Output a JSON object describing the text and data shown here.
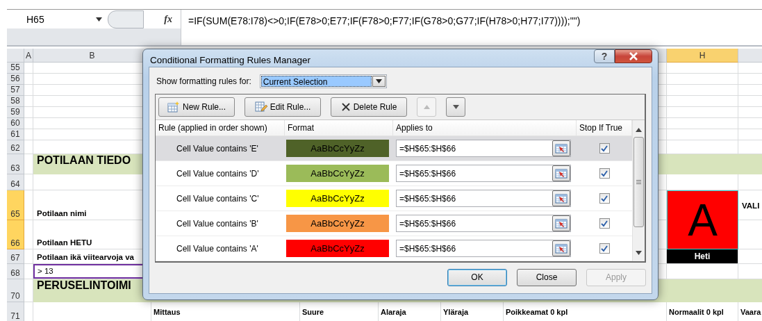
{
  "formula_bar": {
    "name_box": "H65",
    "function_label": "fx",
    "formula": "=IF(SUM(E78:I78)<>0;IF(E78>0;E77;IF(F78>0;F77;IF(G78>0;G77;IF(H78>0;H77;I77))));\"\")"
  },
  "column_headers": [
    {
      "label": "A",
      "selected": false
    },
    {
      "label": "B",
      "selected": false
    },
    {
      "label": "H",
      "selected": true
    }
  ],
  "row_headers": [
    {
      "label": "55",
      "selected": false
    },
    {
      "label": "56",
      "selected": false
    },
    {
      "label": "57",
      "selected": false
    },
    {
      "label": "58",
      "selected": false
    },
    {
      "label": "59",
      "selected": false
    },
    {
      "label": "60",
      "selected": false
    },
    {
      "label": "61",
      "selected": false
    },
    {
      "label": "62",
      "selected": false
    },
    {
      "label": "63",
      "selected": false
    },
    {
      "label": "64",
      "selected": false
    },
    {
      "label": "65",
      "selected": true
    },
    {
      "label": "66",
      "selected": true
    },
    {
      "label": "67",
      "selected": false
    },
    {
      "label": "68",
      "selected": false
    },
    {
      "label": "70",
      "selected": false
    },
    {
      "label": "71",
      "selected": false
    }
  ],
  "sheet": {
    "patient_section": "POTILAAN TIEDO",
    "fields": [
      "Potilaan nimi",
      "Potilaan HETU",
      "Potilaan ikä viitearvoja va"
    ],
    "age_value": "> 13",
    "grade": {
      "letter": "A",
      "color": "#ff0000",
      "caption": "Heti"
    },
    "side_label": "VALI",
    "vital_section": "PERUSELINTOIMI",
    "table_headers": [
      "Mittaus",
      "Suure",
      "Alaraja",
      "Yläraja",
      "Poikkeamat 0 kpl",
      "Normaalit 0 kpl",
      "Vaara"
    ]
  },
  "dialog": {
    "title": "Conditional Formatting Rules Manager",
    "help_label": "?",
    "scope_label": "Show formatting rules for:",
    "scope_value": "Current Selection",
    "toolbar": [
      {
        "kind": "new",
        "label": "New Rule..."
      },
      {
        "kind": "edit",
        "label": "Edit Rule..."
      },
      {
        "kind": "delete",
        "label": "Delete Rule"
      },
      {
        "kind": "up",
        "disabled": true
      },
      {
        "kind": "down",
        "disabled": false
      }
    ],
    "columns": [
      "Rule (applied in order shown)",
      "Format",
      "Applies to",
      "Stop If True"
    ],
    "rules": [
      {
        "rule": "Cell Value contains 'E'",
        "sample": "AaBbCcYyZz",
        "color": "#4f6228",
        "applies_to": "=$H$65:$H$66",
        "stop_if_true": true,
        "selected": true
      },
      {
        "rule": "Cell Value contains 'D'",
        "sample": "AaBbCcYyZz",
        "color": "#9bbb59",
        "applies_to": "=$H$65:$H$66",
        "stop_if_true": true,
        "selected": false
      },
      {
        "rule": "Cell Value contains 'C'",
        "sample": "AaBbCcYyZz",
        "color": "#ffff00",
        "applies_to": "=$H$65:$H$66",
        "stop_if_true": true,
        "selected": false
      },
      {
        "rule": "Cell Value contains 'B'",
        "sample": "AaBbCcYyZz",
        "color": "#f79646",
        "applies_to": "=$H$65:$H$66",
        "stop_if_true": true,
        "selected": false
      },
      {
        "rule": "Cell Value contains 'A'",
        "sample": "AaBbCcYyZz",
        "color": "#ff0000",
        "applies_to": "=$H$65:$H$66",
        "stop_if_true": true,
        "selected": false
      }
    ],
    "buttons": [
      {
        "label": "OK",
        "default": true,
        "disabled": false
      },
      {
        "label": "Close",
        "default": false,
        "disabled": false
      },
      {
        "label": "Apply",
        "default": false,
        "disabled": true
      }
    ]
  }
}
